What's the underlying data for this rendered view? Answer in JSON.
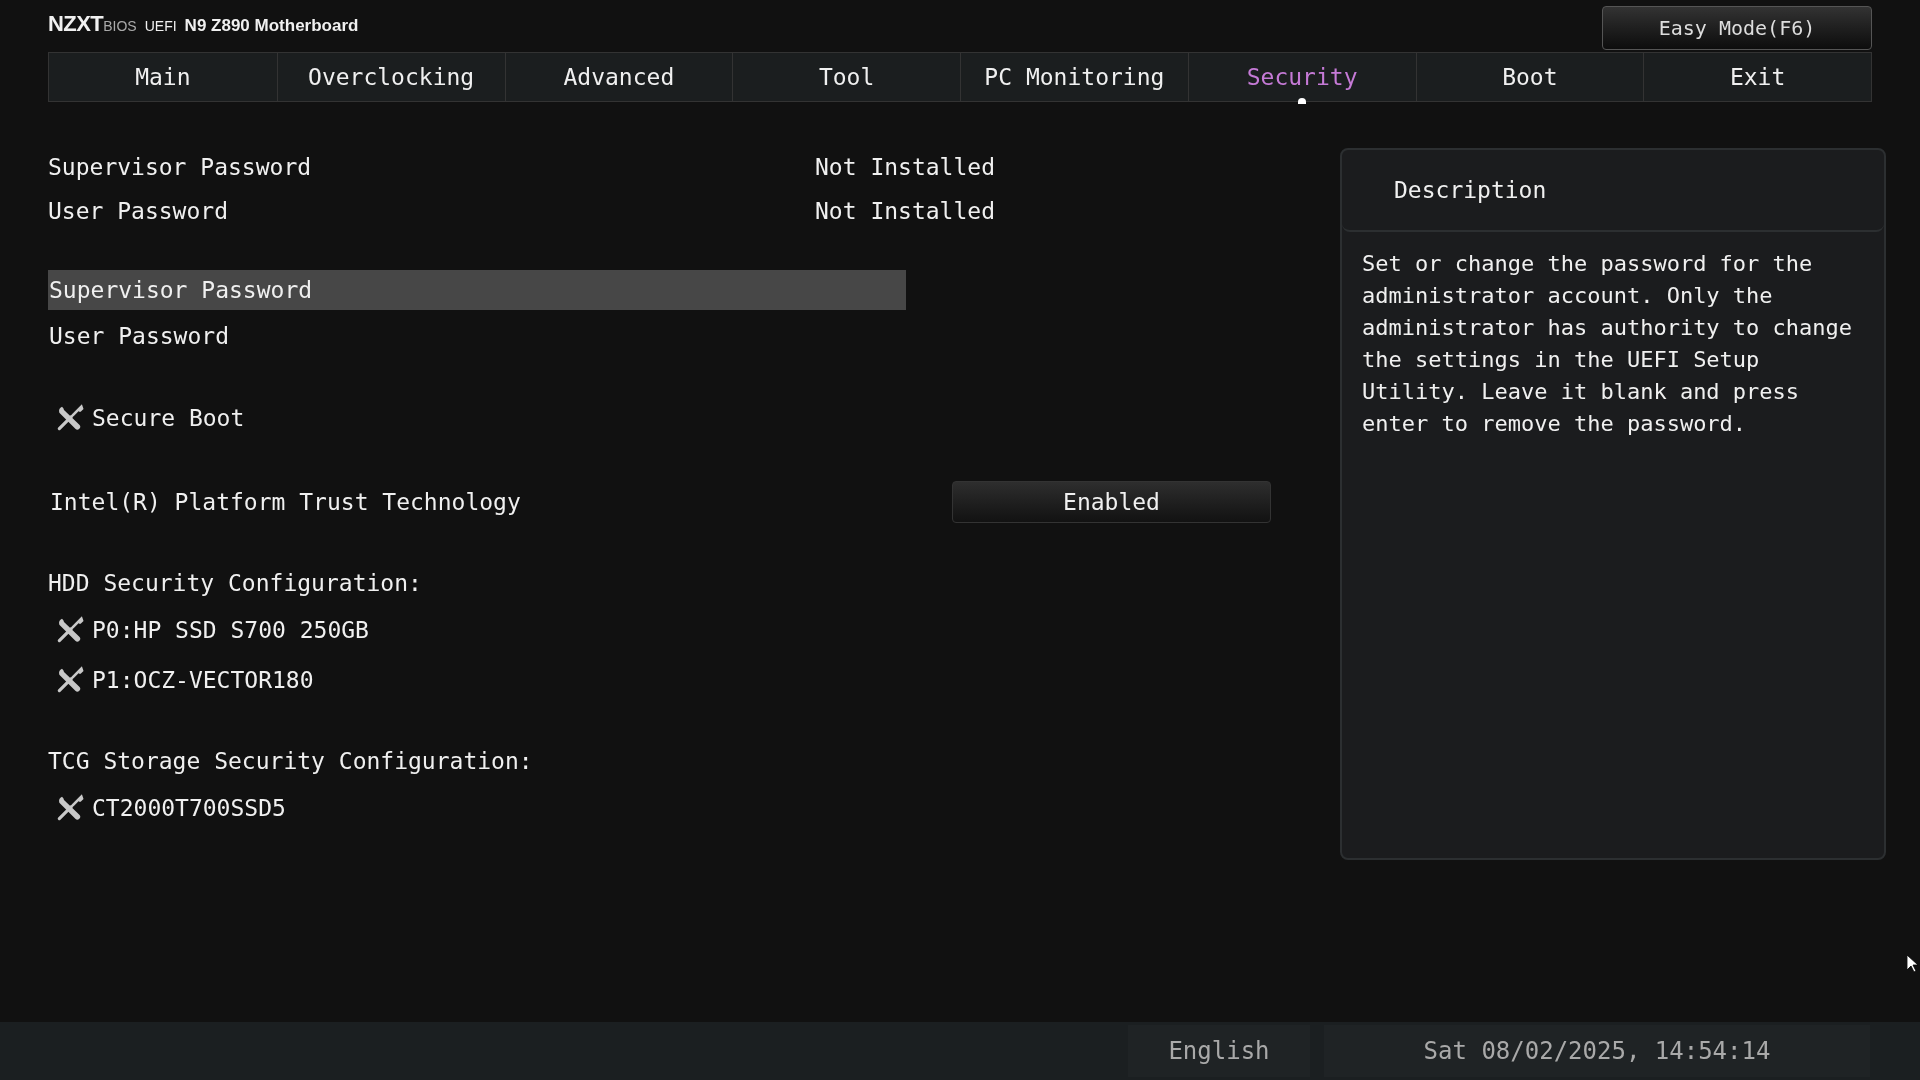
{
  "header": {
    "brand": "NZXT",
    "brand_sub": "BIOS",
    "firmware": "UEFI",
    "model": "N9 Z890 Motherboard",
    "easy_mode_button": "Easy Mode(F6)"
  },
  "tabs": [
    {
      "label": "Main",
      "selected": false
    },
    {
      "label": "Overclocking",
      "selected": false
    },
    {
      "label": "Advanced",
      "selected": false
    },
    {
      "label": "Tool",
      "selected": false
    },
    {
      "label": "PC Monitoring",
      "selected": false
    },
    {
      "label": "Security",
      "selected": true
    },
    {
      "label": "Boot",
      "selected": false
    },
    {
      "label": "Exit",
      "selected": false
    }
  ],
  "sections": [
    {
      "items": [
        {
          "kind": "info",
          "label": "Supervisor Password",
          "value": "Not Installed"
        },
        {
          "kind": "info",
          "label": "User Password",
          "value": "Not Installed"
        }
      ]
    },
    {
      "items": [
        {
          "kind": "item",
          "label": "Supervisor Password",
          "selected": true
        },
        {
          "kind": "item",
          "label": "User Password",
          "selected": false
        }
      ]
    },
    {
      "items": [
        {
          "kind": "submenu",
          "label": "Secure Boot",
          "selected": false
        }
      ]
    },
    {
      "items": [
        {
          "kind": "option",
          "label": "Intel(R) Platform Trust Technology",
          "value": "Enabled",
          "selected": false
        }
      ]
    },
    {
      "items": [
        {
          "kind": "header",
          "label": "HDD Security Configuration:"
        },
        {
          "kind": "submenu",
          "label": "P0:HP SSD S700 250GB",
          "selected": false
        },
        {
          "kind": "submenu",
          "label": "P1:OCZ-VECTOR180",
          "selected": false
        }
      ]
    },
    {
      "items": [
        {
          "kind": "header",
          "label": "TCG Storage Security Configuration:"
        },
        {
          "kind": "submenu",
          "label": "CT2000T700SSD5",
          "selected": false
        }
      ]
    }
  ],
  "description": {
    "title": "Description",
    "text": "Set or change the password for the administrator account. Only the administrator has authority to change the settings in the UEFI Setup Utility. Leave it blank and press enter to remove the password."
  },
  "status_bar": {
    "language": "English",
    "datetime": "Sat 08/02/2025, 14:54:14"
  }
}
